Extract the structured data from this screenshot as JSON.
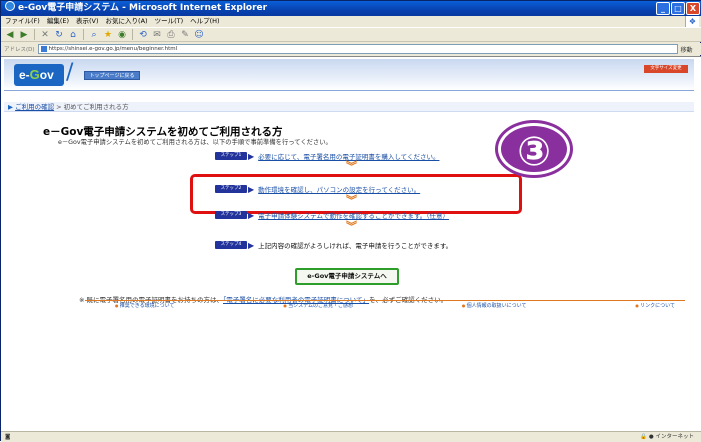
{
  "window": {
    "title": "e-Gov電子申請システム - Microsoft Internet Explorer",
    "btn_min": "_",
    "btn_max": "□",
    "btn_close": "X"
  },
  "menu": [
    "ファイル(F)",
    "編集(E)",
    "表示(V)",
    "お気に入り(A)",
    "ツール(T)",
    "ヘルプ(H)"
  ],
  "address": {
    "label": "アドレス(D)",
    "url": "https://shinsei.e-gov.go.jp/menu/beginner.html",
    "go_label": "移動"
  },
  "banner": {
    "logo_e": "e-",
    "logo_g": "G",
    "logo_rest": "ov",
    "top_button": "トップページに戻る",
    "right_button": "文字サイズ変更"
  },
  "breadcrumb": {
    "link": "ご利用の確認",
    "current": "初めてご利用される方"
  },
  "main": {
    "title": "e－Gov電子申請システムを初めてご利用される方",
    "subtitle": "e－Gov電子申請システムを初めてご利用される方は、以下の手順で事前準備を行ってください。",
    "steps": [
      {
        "badge": "ステップ1",
        "text": "必要に応じて、電子署名用の電子証明書を購入してください。"
      },
      {
        "badge": "ステップ2",
        "text": "動作環境を確認し、パソコンの設定を行ってください。"
      },
      {
        "badge": "ステップ3",
        "text": "電子申請体験システムで動作を確認することができます。（任意）"
      },
      {
        "badge": "ステップ4",
        "text": "上記内容の確認がよろしければ、電子申請を行うことができます。"
      }
    ],
    "callout_number": "③",
    "cta_label": "e-Gov電子申請システムへ",
    "note_prefix": "※ 既に電子署名用の電子証明書をお持ちの方は、",
    "note_link": "「電子署名に必要な利用者の電子証明書について」",
    "note_suffix": "を、必ずご確認ください。",
    "footer_links": [
      "推奨できる環境について",
      "当システムのご意見・ご感想",
      "個人情報の取扱いについて",
      "リンクについて"
    ]
  },
  "status": {
    "left": "",
    "zone": "インターネット"
  }
}
